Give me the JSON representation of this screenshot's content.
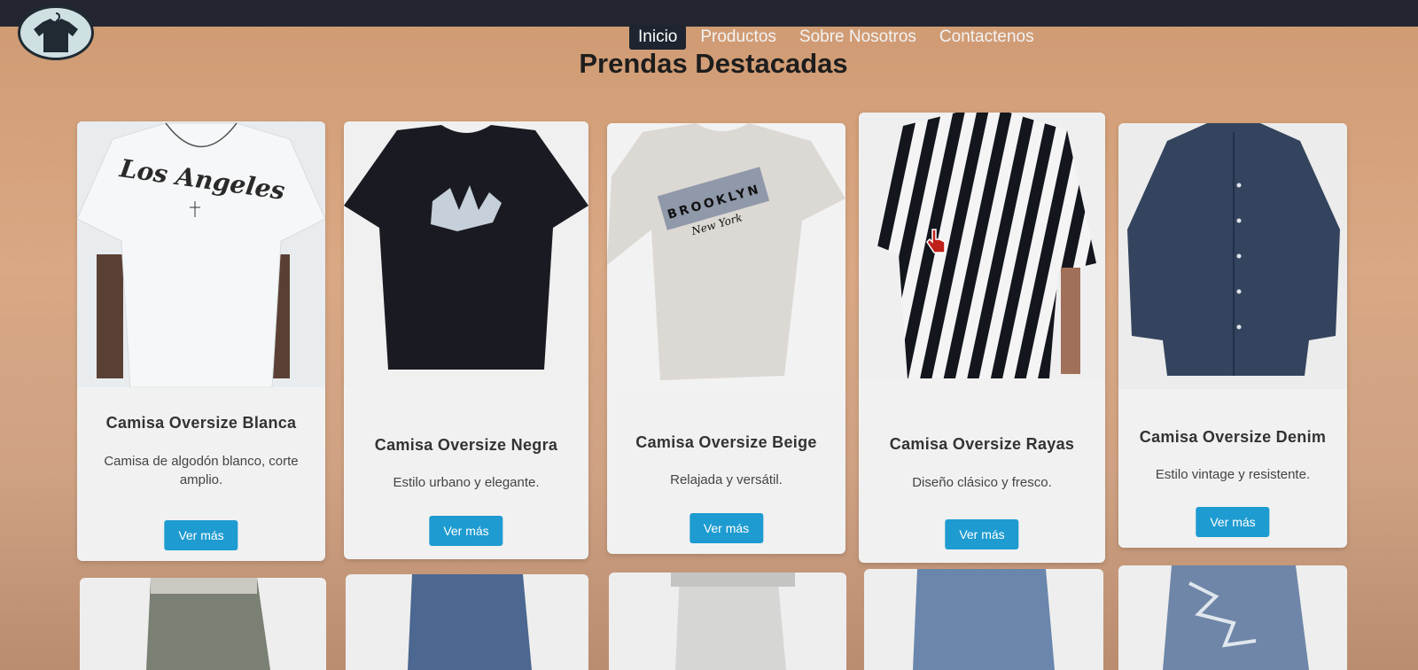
{
  "nav": {
    "items": [
      {
        "label": "Inicio",
        "active": true
      },
      {
        "label": "Productos"
      },
      {
        "label": "Sobre Nosotros"
      },
      {
        "label": "Contactenos"
      }
    ]
  },
  "page": {
    "title": "Prendas Destacadas"
  },
  "products": [
    {
      "name": "Camisa Oversize Blanca",
      "desc": "Camisa de algodón blanco, corte amplio.",
      "button": "Ver más",
      "image_text": "Los Angeles"
    },
    {
      "name": "Camisa Oversize Negra",
      "desc": "Estilo urbano y elegante.",
      "button": "Ver más"
    },
    {
      "name": "Camisa Oversize Beige",
      "desc": "Relajada y versátil.",
      "button": "Ver más",
      "image_text": "BROOKLYN",
      "image_subtext": "New York"
    },
    {
      "name": "Camisa Oversize Rayas",
      "desc": "Diseño clásico y fresco.",
      "button": "Ver más"
    },
    {
      "name": "Camisa Oversize Denim",
      "desc": "Estilo vintage y resistente.",
      "button": "Ver más"
    }
  ],
  "colors": {
    "accent": "#1e9bd0",
    "nav_active": "#1e2430",
    "topbar": "#23262f"
  },
  "icons": {
    "logo": "tshirt-hanger-icon",
    "cursor": "hand-pointer-icon"
  }
}
